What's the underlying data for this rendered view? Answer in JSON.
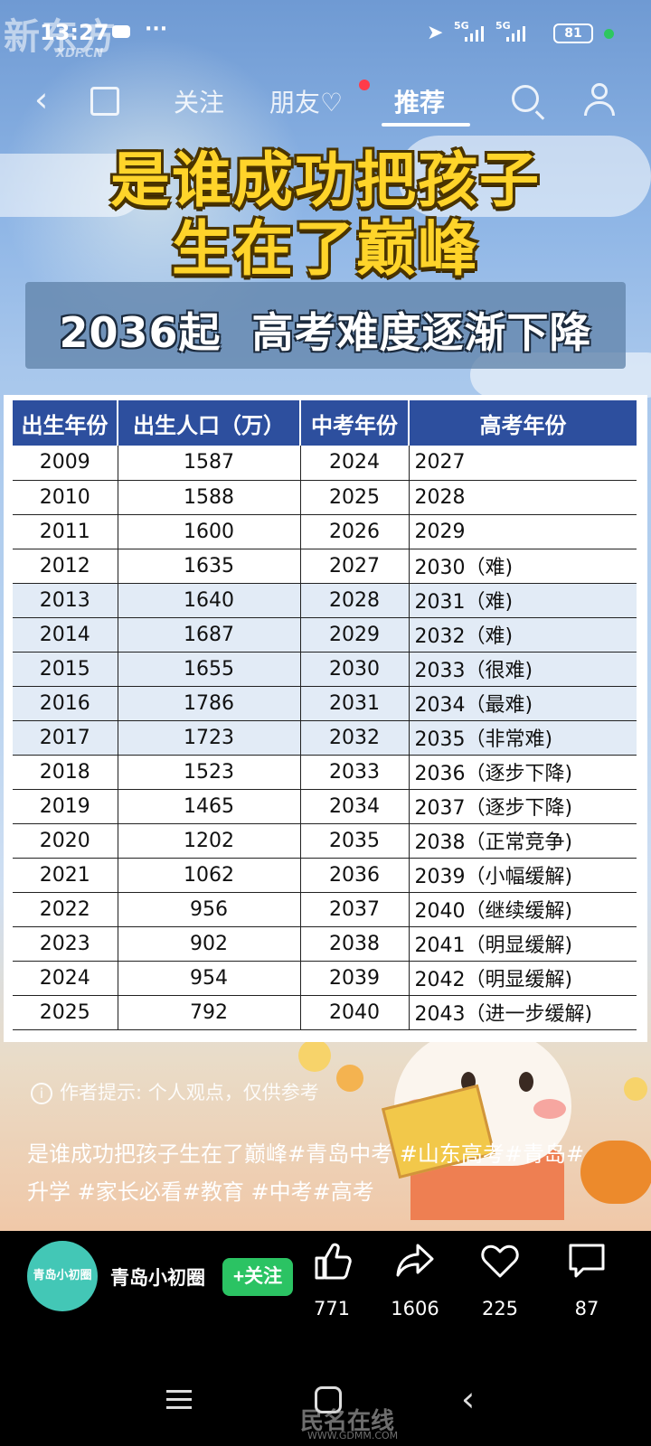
{
  "status_bar": {
    "time": "13:27",
    "more": "···",
    "signal1": "5G",
    "signal2": "5G",
    "battery": "81"
  },
  "watermark": {
    "brand": "新东方",
    "site": "XDF.CN"
  },
  "nav": {
    "tabs": [
      {
        "label": "关注"
      },
      {
        "label": "朋友♡"
      },
      {
        "label": "推荐"
      }
    ]
  },
  "post": {
    "headline_line1": "是谁成功把孩子",
    "headline_line2": "生在了巅峰",
    "subheadline": "2036起  高考难度逐渐下降",
    "table": {
      "headers": [
        "出生年份",
        "出生人口（万）",
        "中考年份",
        "高考年份"
      ],
      "rows": [
        [
          "2009",
          "1587",
          "2024",
          "2027"
        ],
        [
          "2010",
          "1588",
          "2025",
          "2028"
        ],
        [
          "2011",
          "1600",
          "2026",
          "2029"
        ],
        [
          "2012",
          "1635",
          "2027",
          "2030（难)"
        ],
        [
          "2013",
          "1640",
          "2028",
          "2031（难)"
        ],
        [
          "2014",
          "1687",
          "2029",
          "2032（难)"
        ],
        [
          "2015",
          "1655",
          "2030",
          "2033（很难)"
        ],
        [
          "2016",
          "1786",
          "2031",
          "2034（最难)"
        ],
        [
          "2017",
          "1723",
          "2032",
          "2035（非常难)"
        ],
        [
          "2018",
          "1523",
          "2033",
          "2036（逐步下降)"
        ],
        [
          "2019",
          "1465",
          "2034",
          "2037（逐步下降)"
        ],
        [
          "2020",
          "1202",
          "2035",
          "2038（正常竞争)"
        ],
        [
          "2021",
          "1062",
          "2036",
          "2039（小幅缓解)"
        ],
        [
          "2022",
          "956",
          "2037",
          "2040（继续缓解)"
        ],
        [
          "2023",
          "902",
          "2038",
          "2041（明显缓解)"
        ],
        [
          "2024",
          "954",
          "2039",
          "2042（明显缓解)"
        ],
        [
          "2025",
          "792",
          "2040",
          "2043（进一步缓解)"
        ]
      ],
      "shaded_rows": [
        4,
        5,
        6,
        7,
        8
      ]
    },
    "author_tip": "作者提示: 个人观点，仅供参考",
    "description": "是谁成功把孩子生在了巅峰#青岛中考 #山东高考#青岛#升学 #家长必看#教育 #中考#高考"
  },
  "author": {
    "avatar_text": "青岛小初圈",
    "name": "青岛小初圈",
    "follow_label": "+关注"
  },
  "actions": {
    "like_count": "771",
    "share_count": "1606",
    "favorite_count": "225",
    "comment_count": "87"
  },
  "bottom_watermark": {
    "brand": "民名在线",
    "site": "WWW.GDMM.COM"
  },
  "colors": {
    "table_header": "#2d4f9e",
    "headline": "#ffd42a",
    "follow_button": "#2bc363",
    "avatar": "#43c7b6"
  }
}
